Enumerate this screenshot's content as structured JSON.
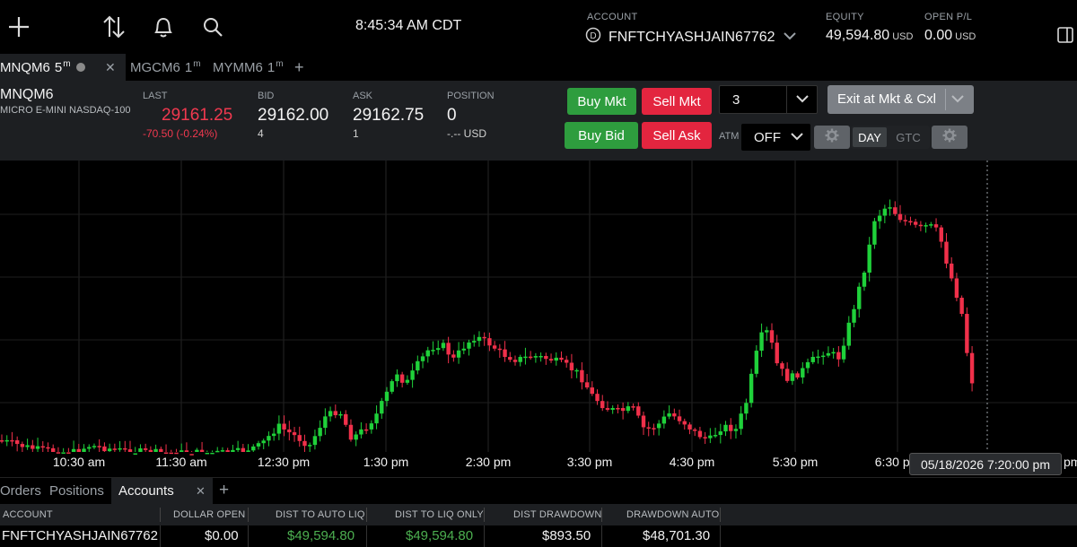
{
  "topbar": {
    "time": "8:45:34 AM CDT",
    "account_label": "ACCOUNT",
    "account_name": "FNFTCHYASHJAIN67762",
    "equity_label": "EQUITY",
    "equity_value": "49,594.80",
    "equity_unit": "USD",
    "open_pl_label": "OPEN P/L",
    "open_pl_value": "0.00",
    "open_pl_unit": "USD",
    "icons": [
      "plus-icon",
      "transfer-arrows-icon",
      "bell-icon",
      "search-icon",
      "account-badge-icon",
      "chevron-down-icon",
      "sidebar-toggle-icon"
    ]
  },
  "chart_tabs": [
    {
      "symbol": "MNQM6",
      "interval": "5",
      "unit": "m",
      "active": true
    },
    {
      "symbol": "MGCM6",
      "interval": "1",
      "unit": "m",
      "active": false
    },
    {
      "symbol": "MYMM6",
      "interval": "1",
      "unit": "m",
      "active": false
    }
  ],
  "instrument": {
    "symbol": "MNQM6",
    "description": "MICRO E-MINI NASDAQ-100",
    "last_label": "LAST",
    "last_value": "29161.25",
    "last_change": "-70.50 (-0.24%)",
    "bid_label": "BID",
    "bid_value": "29162.00",
    "bid_size": "4",
    "ask_label": "ASK",
    "ask_value": "29162.75",
    "ask_size": "1",
    "position_label": "POSITION",
    "position_value": "0",
    "position_pl": "-.-- USD"
  },
  "order_entry": {
    "buy_mkt": "Buy Mkt",
    "sell_mkt": "Sell Mkt",
    "buy_bid": "Buy Bid",
    "sell_ask": "Sell Ask",
    "quantity": "3",
    "exit_label": "Exit at Mkt & Cxl",
    "atm_label": "ATM",
    "atm_value": "OFF",
    "tif_day": "DAY",
    "tif_gtc": "GTC",
    "tif_selected": "DAY"
  },
  "chart": {
    "time_labels": [
      "10:30 am",
      "11:30 am",
      "12:30 pm",
      "1:30 pm",
      "2:30 pm",
      "3:30 pm",
      "4:30 pm",
      "5:30 pm",
      "6:30 pm"
    ],
    "crosshair_time": "05/18/2026 7:20:00 pm",
    "up_color": "#1fd13a",
    "down_color": "#f0304a"
  },
  "bottom_tabs": {
    "orders": "Orders",
    "positions": "Positions",
    "accounts": "Accounts",
    "active": "Accounts"
  },
  "accounts_table": {
    "headers": [
      "ACCOUNT",
      "DOLLAR OPEN",
      "DIST TO AUTO LIQ",
      "DIST TO LIQ ONLY",
      "DIST DRAWDOWN",
      "DRAWDOWN AUTO"
    ],
    "rows": [
      [
        "FNFTCHYASHJAIN67762",
        "$0.00",
        "$49,594.80",
        "$49,594.80",
        "$893.50",
        "$48,701.30"
      ]
    ]
  },
  "colors": {
    "buy": "#2e9d3e",
    "sell": "#e3253f",
    "positive_text": "#4caf50",
    "negative_text": "#f0394f",
    "panel": "#1d1f22"
  }
}
